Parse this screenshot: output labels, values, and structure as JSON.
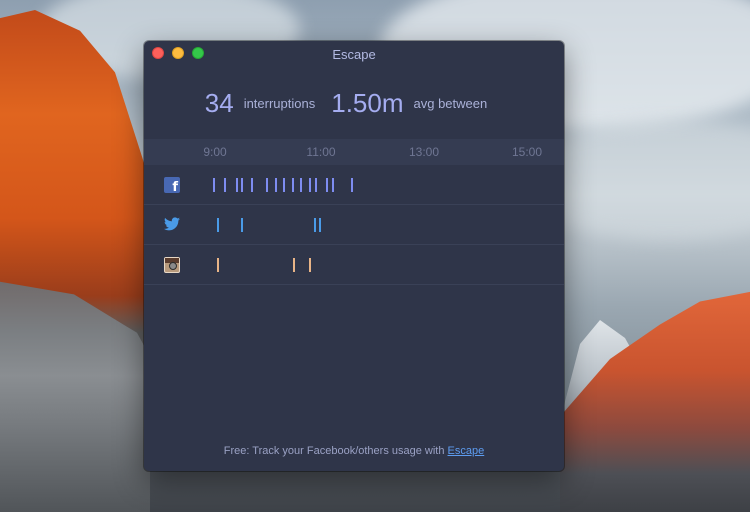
{
  "window": {
    "title": "Escape"
  },
  "stats": {
    "interruptions_value": "34",
    "interruptions_label": "interruptions",
    "avg_value": "1.50m",
    "avg_label": "avg between"
  },
  "timeline": {
    "ticks": [
      "9:00",
      "11:00",
      "13:00",
      "15:00"
    ]
  },
  "rows": [
    {
      "app": "facebook",
      "icon": "facebook-icon",
      "color": "#7e8cf0",
      "events": [
        0.01,
        0.04,
        0.075,
        0.09,
        0.12,
        0.165,
        0.19,
        0.215,
        0.24,
        0.265,
        0.29,
        0.31,
        0.34,
        0.36,
        0.415
      ]
    },
    {
      "app": "twitter",
      "icon": "twitter-icon",
      "color": "#4a9be8",
      "events": [
        0.02,
        0.09,
        0.305,
        0.32
      ]
    },
    {
      "app": "instagram",
      "icon": "instagram-icon",
      "color": "#e8b487",
      "events": [
        0.02,
        0.245,
        0.29
      ]
    }
  ],
  "footer": {
    "text": "Free: Track your Facebook/others usage with ",
    "link": "Escape"
  }
}
